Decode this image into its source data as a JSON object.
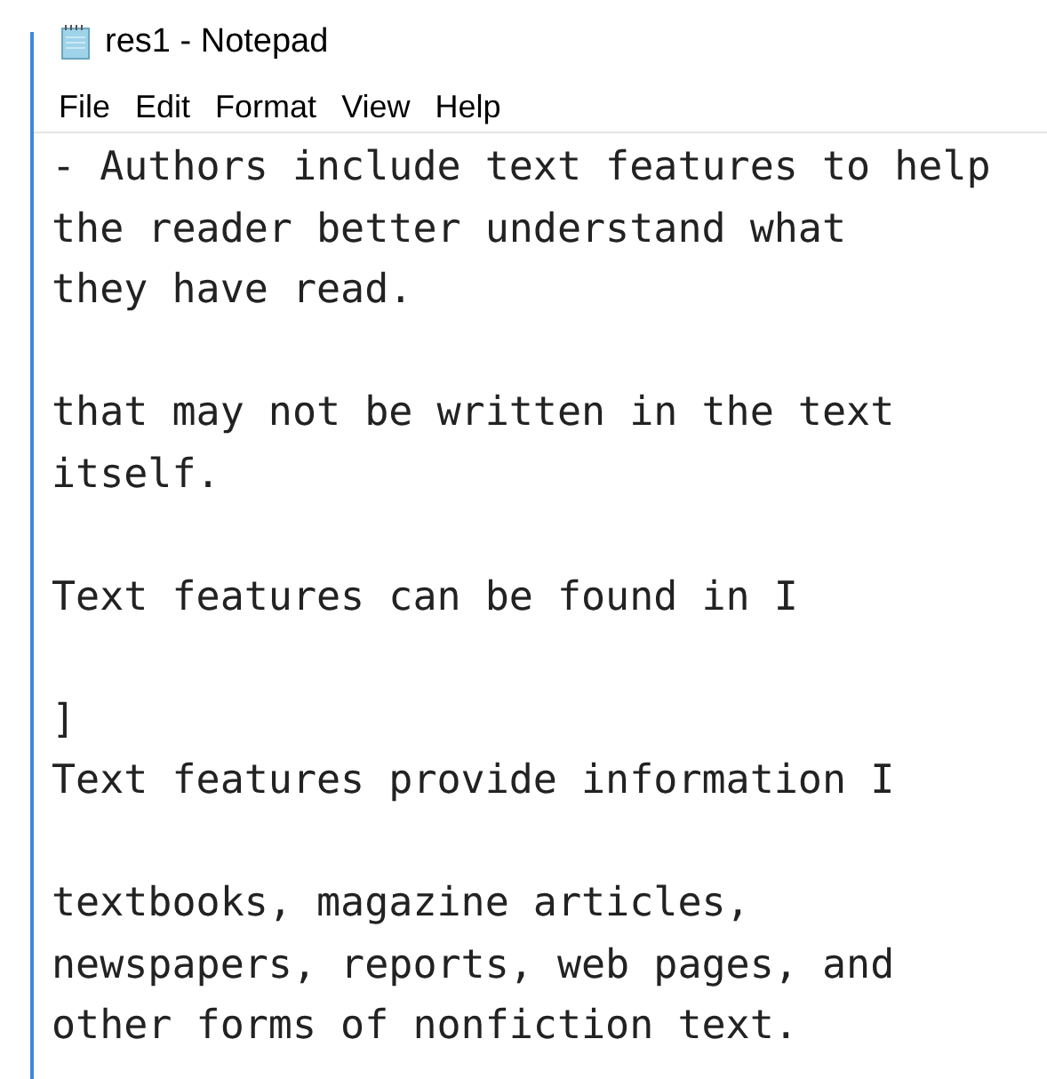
{
  "window": {
    "title": "res1 - Notepad"
  },
  "menu": [
    "File",
    "Edit",
    "Format",
    "View",
    "Help"
  ],
  "paragraphs": [
    [
      "- Authors include text features to help",
      "the reader better understand what",
      "they have read."
    ],
    [
      "that may not be written in the text",
      "itself."
    ],
    [
      "Text features can be found in I"
    ],
    [
      "]",
      "Text features provide information I"
    ],
    [
      "textbooks, magazine articles,",
      "newspapers, reports, web pages, and",
      "other forms of nonfiction text."
    ]
  ]
}
